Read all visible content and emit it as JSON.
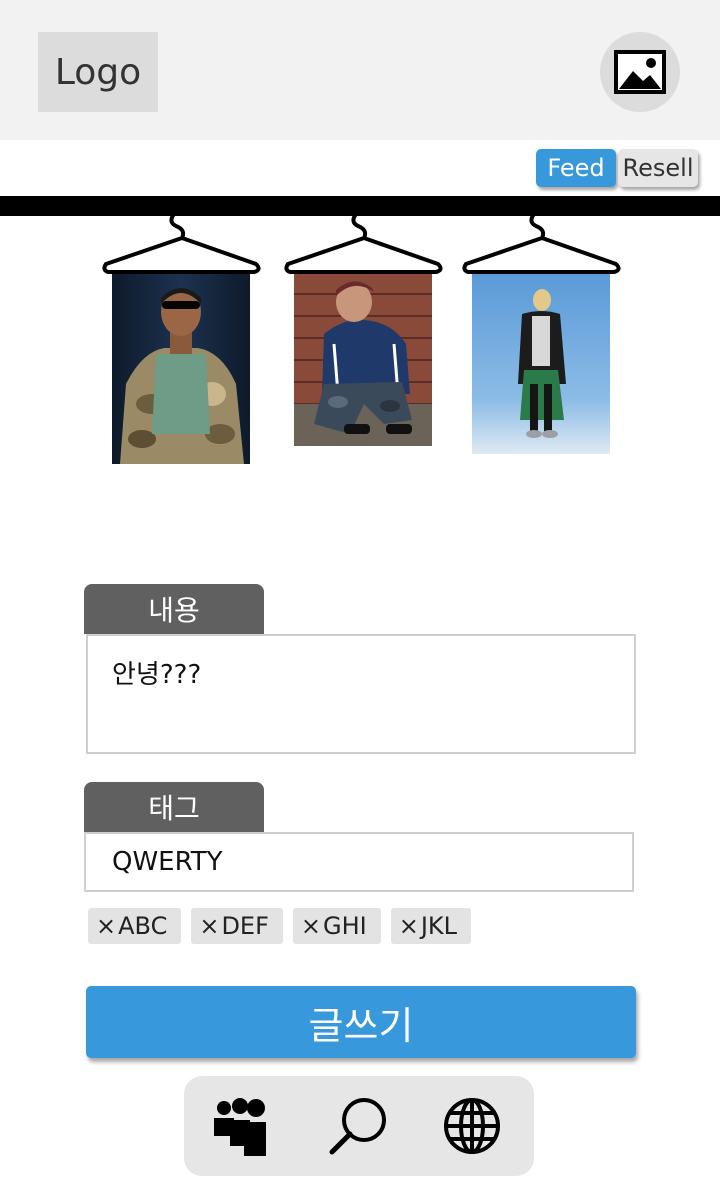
{
  "header": {
    "logo_text": "Logo",
    "image_button_icon": "image-icon"
  },
  "mode_toggle": {
    "feed_label": "Feed",
    "resell_label": "Resell",
    "active": "Feed"
  },
  "hanging_photos": [
    {
      "description_icon": "photo-camo-hoodie"
    },
    {
      "description_icon": "photo-track-jacket"
    },
    {
      "description_icon": "photo-long-coat"
    }
  ],
  "form": {
    "content_label": "내용",
    "content_value": "안녕???",
    "tag_label": "태그",
    "tag_value": "QWERTY",
    "tags": [
      "ABC",
      "DEF",
      "GHI",
      "JKL"
    ],
    "chip_remove_glyph": "×",
    "submit_label": "글쓰기"
  },
  "bottom_nav": {
    "icons": [
      "people-icon",
      "search-icon",
      "globe-icon"
    ]
  },
  "colors": {
    "accent": "#3898dc",
    "header_bg": "#f2f2f2",
    "label_bg": "#606060",
    "chip_bg": "#e3e3e3",
    "nav_bg": "#e6e6e6"
  }
}
